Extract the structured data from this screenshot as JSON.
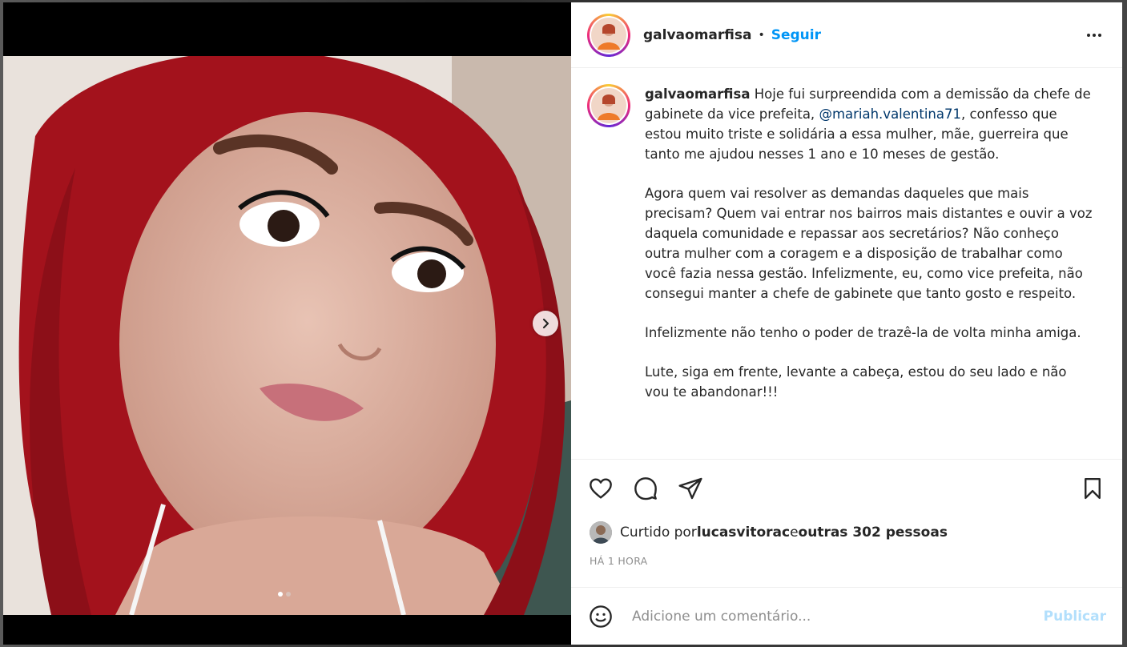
{
  "post": {
    "username": "galvaomarfisa",
    "separator": "•",
    "follow_label": "Seguir",
    "more_icon": "more-horizontal-icon",
    "caption": {
      "username": "galvaomarfisa",
      "p1_before": " Hoje fui surpreendida com a demissão da chefe de gabinete da vice prefeita, ",
      "mention": "@mariah.valentina71",
      "p1_after": ", confesso que estou muito triste e solidária a essa mulher, mãe, guerreira que tanto me ajudou nesses 1 ano e 10 meses de gestão.",
      "p2": "Agora quem vai resolver as demandas daqueles que mais precisam? Quem vai entrar nos bairros mais distantes e ouvir a voz daquela comunidade e repassar aos secretários? Não conheço outra mulher com a coragem e a disposição de trabalhar como você fazia nessa gestão. Infelizmente, eu, como vice prefeita, não consegui manter a chefe de gabinete que tanto gosto e respeito.",
      "p3": "Infelizmente não tenho o poder de trazê-la de volta minha amiga.",
      "p4": "Lute, siga em frente, levante a cabeça, estou do seu lado e não vou te abandonar!!!"
    },
    "likes": {
      "prefix": "Curtido por ",
      "liker": "lucasvitorac",
      "middle": " e ",
      "others": "outras 302 pessoas"
    },
    "timestamp": "HÁ 1 HORA",
    "carousel": {
      "total": 2,
      "current": 1
    }
  },
  "comment_box": {
    "placeholder": "Adicione um comentário...",
    "publish_label": "Publicar"
  },
  "colors": {
    "link_blue": "#0095f6",
    "mention_blue": "#00376b",
    "publish_disabled": "#b2dffc",
    "text": "#262626",
    "muted": "#8e8e8e"
  }
}
